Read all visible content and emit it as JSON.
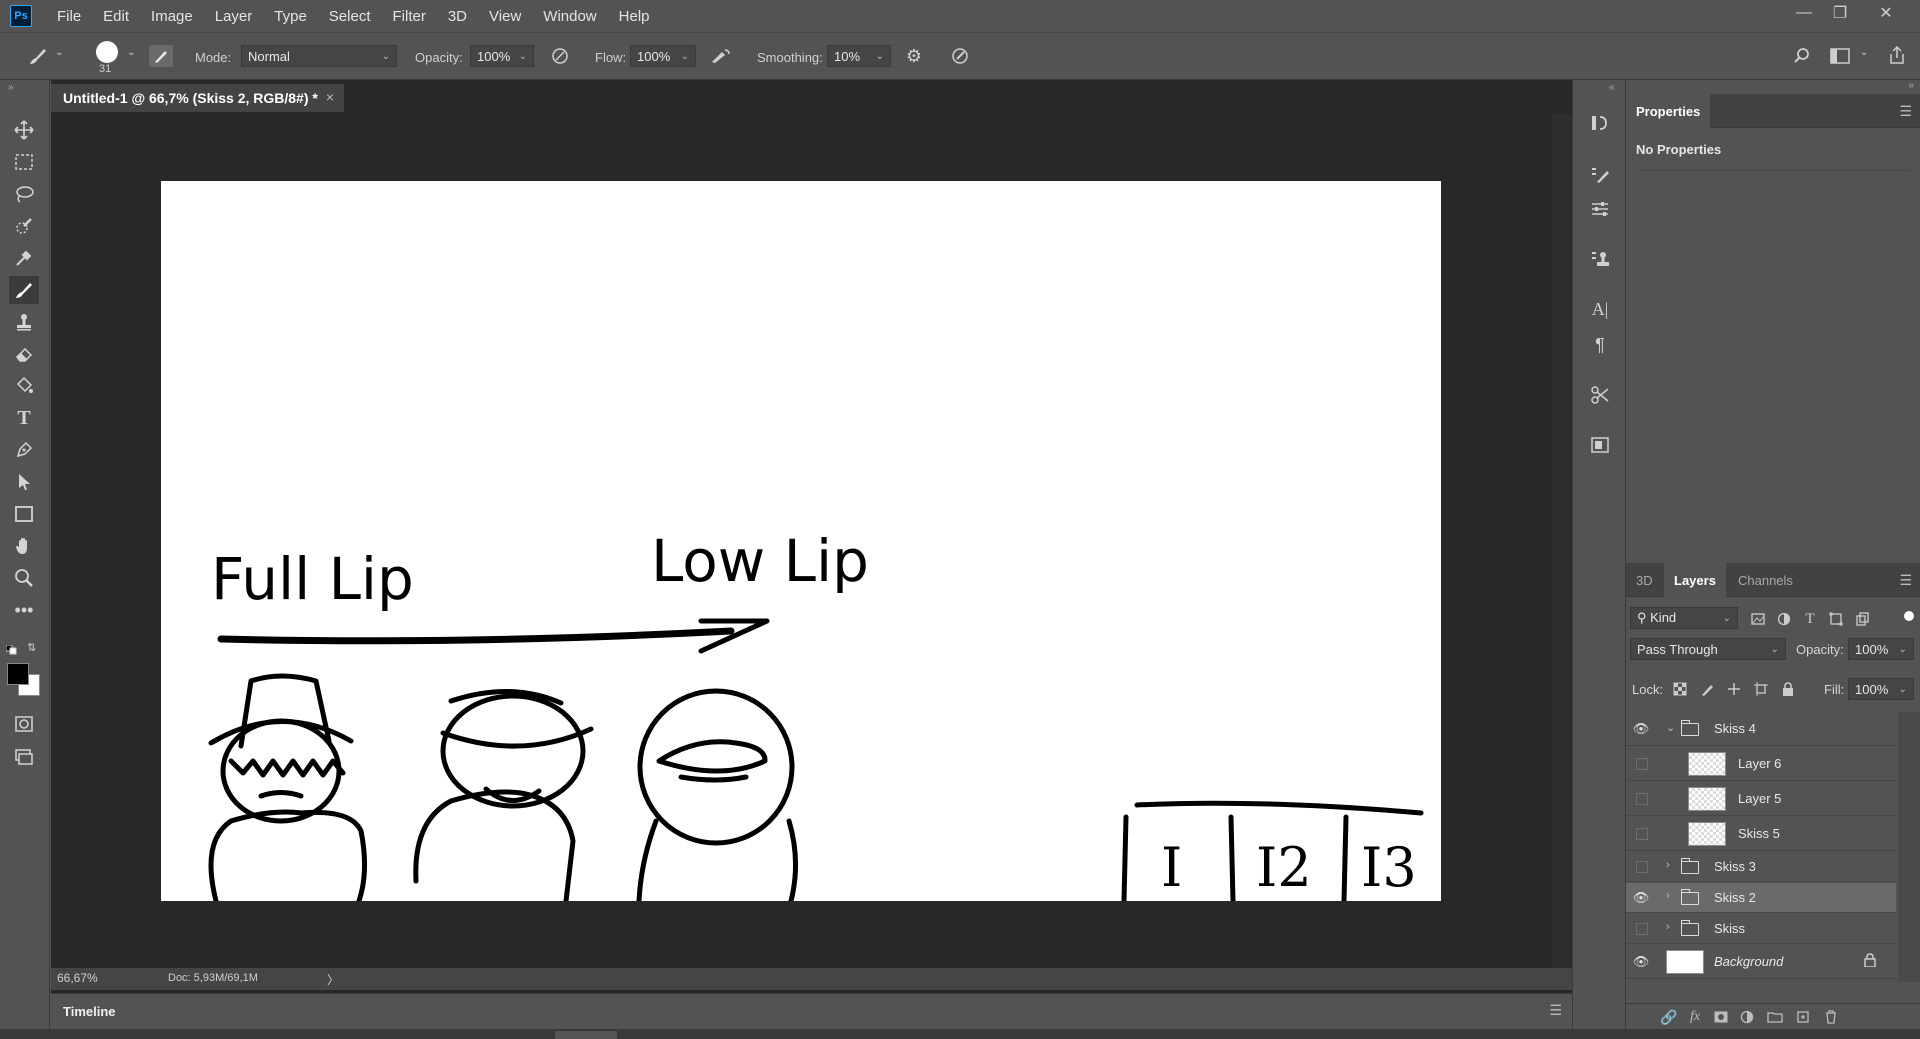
{
  "menubar": {
    "logo": "Ps",
    "items": [
      "File",
      "Edit",
      "Image",
      "Layer",
      "Type",
      "Select",
      "Filter",
      "3D",
      "View",
      "Window",
      "Help"
    ]
  },
  "options": {
    "brush_size": "31",
    "mode_label": "Mode:",
    "mode_value": "Normal",
    "opacity_label": "Opacity:",
    "opacity_value": "100%",
    "flow_label": "Flow:",
    "flow_value": "100%",
    "smoothing_label": "Smoothing:",
    "smoothing_value": "10%"
  },
  "document": {
    "tab_title": "Untitled-1 @ 66,7% (Skiss 2, RGB/8#) *",
    "close": "×",
    "zoom": "66,67%",
    "doc_info": "Doc: 5,93M/69,1M",
    "status_arrow": "〉"
  },
  "sketch": {
    "text_full_lip": "Full Lip",
    "text_low_lip": "Low Lip",
    "box_labels": [
      "I",
      "I2",
      "I3"
    ]
  },
  "timeline": {
    "label": "Timeline"
  },
  "properties": {
    "tab": "Properties",
    "empty_text": "No Properties"
  },
  "layers_panel": {
    "tabs": [
      "3D",
      "Layers",
      "Channels"
    ],
    "filter_kind": "Kind",
    "blend_mode": "Pass Through",
    "opacity_label": "Opacity:",
    "opacity_value": "100%",
    "lock_label": "Lock:",
    "fill_label": "Fill:",
    "fill_value": "100%",
    "layers": [
      {
        "name": "Skiss 4",
        "type": "group",
        "visible": true,
        "expanded": true
      },
      {
        "name": "Layer 6",
        "type": "layer",
        "visible": false
      },
      {
        "name": "Layer 5",
        "type": "layer",
        "visible": false
      },
      {
        "name": "Skiss 5",
        "type": "layer",
        "visible": false
      },
      {
        "name": "Skiss 3",
        "type": "group",
        "visible": false
      },
      {
        "name": "Skiss 2",
        "type": "group",
        "visible": true,
        "selected": true
      },
      {
        "name": "Skiss",
        "type": "group",
        "visible": false
      },
      {
        "name": "Background",
        "type": "background",
        "visible": true,
        "locked": true
      }
    ]
  },
  "colors": {
    "foreground": "#000000",
    "background": "#ffffff",
    "ui_dark": "#535353",
    "pasteboard": "#282828"
  }
}
